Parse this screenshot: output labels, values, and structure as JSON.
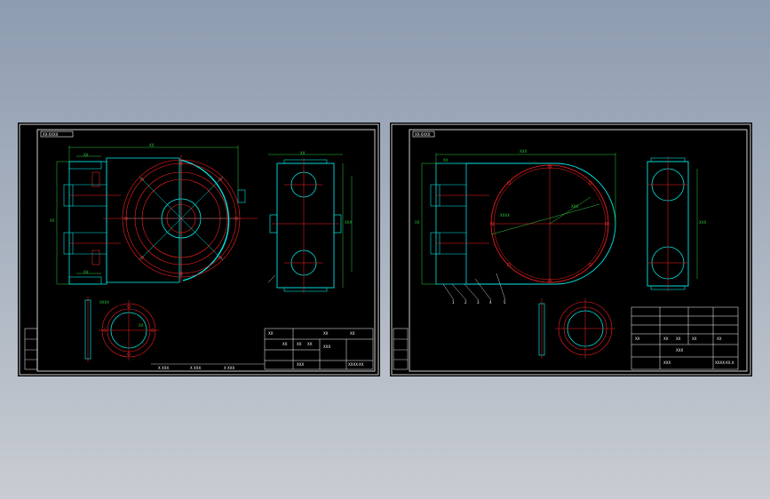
{
  "colors": {
    "background_top": "#8e9cb0",
    "background_bottom": "#c8ccd2",
    "sheet": "#000000",
    "frame": "#ffffff",
    "outline": "#00e5e5",
    "center_line": "#ff2020",
    "dimension": "#2ecc40",
    "bolt": "#ff3030"
  },
  "left_sheet": {
    "header_tag": "XX-XXXX",
    "dim_top": "XX",
    "dims_left": [
      "XX",
      "XX",
      "XX"
    ],
    "dims_side": [
      "XXX",
      "XX"
    ],
    "dims_flange": [
      "XXXX",
      "XX"
    ],
    "title_block": {
      "part_name": "XXX",
      "drawing_no": "XXXX-XX",
      "scale": "XXX",
      "cells": [
        "XX",
        "XX",
        "XX",
        "XX",
        "XX",
        "XX"
      ]
    },
    "bottom_notes": [
      "X XXX",
      "X XXX",
      "X XXX"
    ]
  },
  "right_sheet": {
    "header_tag": "XX-XXXX",
    "dim_top": "XXX",
    "dims_left": [
      "XX",
      "XX"
    ],
    "dims_radius": [
      "XXXX",
      "XXX"
    ],
    "dims_side": [
      "XXX"
    ],
    "leaders": [
      "1",
      "2",
      "3",
      "4",
      "5"
    ],
    "title_block": {
      "part_name": "XXX",
      "drawing_no": "XXXX-XX.X",
      "scale": "XXX",
      "cells": [
        "XX",
        "XX",
        "XX",
        "XX",
        "XX"
      ]
    }
  }
}
